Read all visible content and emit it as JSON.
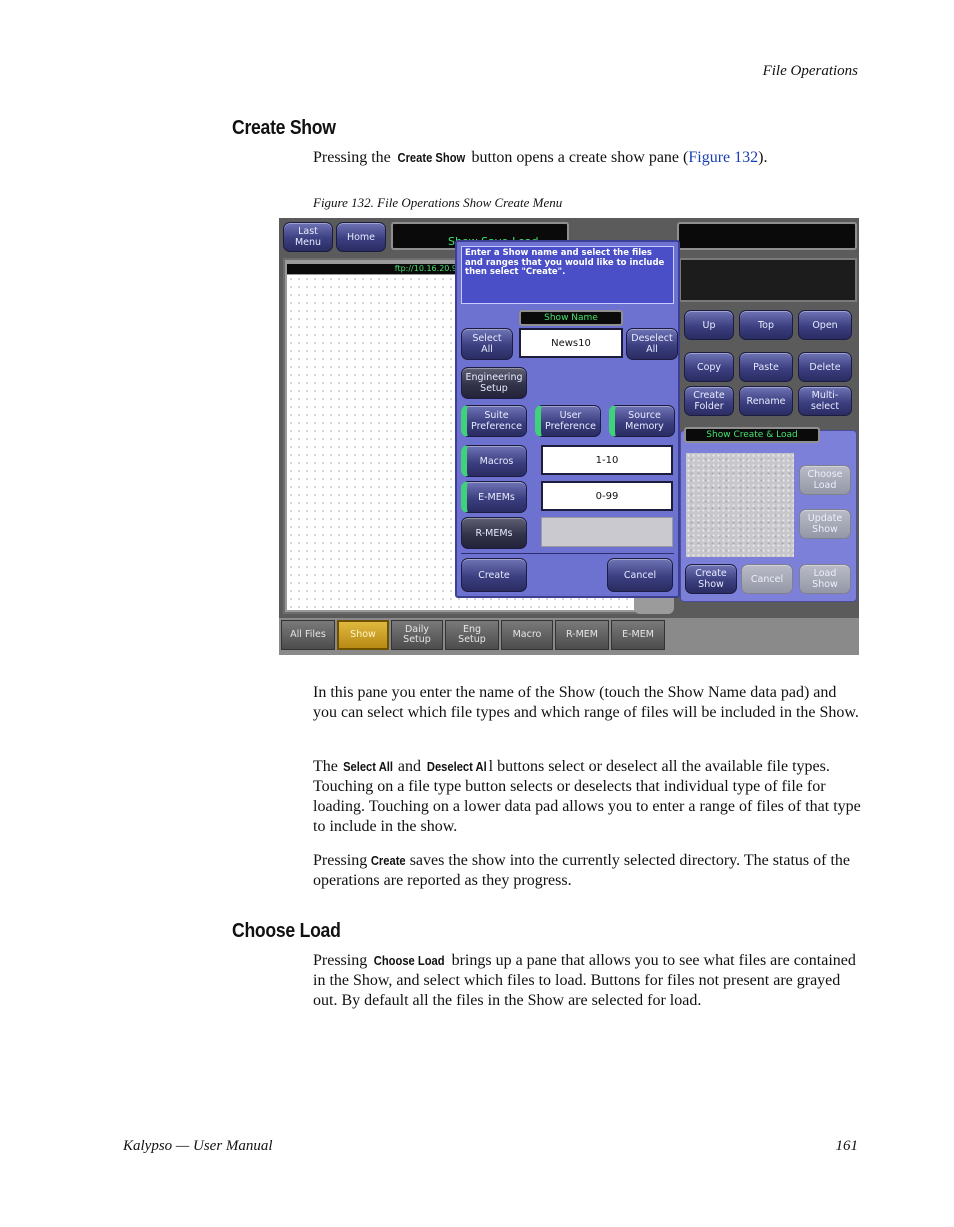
{
  "header": {
    "section": "File Operations"
  },
  "create_show": {
    "heading": "Create Show",
    "intro": {
      "pre": "Pressing the ",
      "kw": "Create Show",
      "mid": " button opens a create show pane (",
      "link": "Figure 132",
      "post": ")."
    },
    "caption": "Figure 132.  File Operations Show Create Menu",
    "para1": "In this pane you enter the name of the Show (touch the Show Name data pad) and you can select which file types and which range of files will be included in the Show.",
    "para2": {
      "pre": "The ",
      "kw1": "Select All",
      "and": " and ",
      "kw2": "Deselect Al",
      "post": "l buttons select or deselect all the available file types. Touching on a file type button selects or deselects that individual type of file for loading. Touching on a lower data pad allows you to enter a range of files of that type to include in the show."
    },
    "para3": {
      "pre": "Pressing ",
      "kw": "Create",
      "post": " saves the show into the currently selected directory. The status of the operations are reported as they progress."
    }
  },
  "choose_load": {
    "heading": "Choose Load",
    "para": {
      "pre": "Pressing ",
      "kw": "Choose Load",
      "post": " brings up a pane that allows you to see what files are contained in the Show, and select which files to load. Buttons for files not present are grayed out. By default all the files in the Show are selected for load."
    }
  },
  "screenshot": {
    "top": {
      "last_menu": "Last\nMenu",
      "home": "Home",
      "title": "Show Save-Load",
      "path": "ftp://10.16.20.9"
    },
    "dialog": {
      "instructions": "Enter a Show name and select the files and ranges that you would like to include then select \"Create\".",
      "show_name_label": "Show Name",
      "show_name_value": "News10",
      "select_all": "Select\nAll",
      "deselect_all": "Deselect\nAll",
      "engineering_setup": "Engineering\nSetup",
      "suite_preference": "Suite\nPreference",
      "user_preference": "User\nPreference",
      "source_memory": "Source\nMemory",
      "macros": "Macros",
      "macros_range": "1-10",
      "emems": "E-MEMs",
      "emems_range": "0-99",
      "rmems": "R-MEMs",
      "create": "Create",
      "cancel": "Cancel"
    },
    "right": {
      "up": "Up",
      "top": "Top",
      "open": "Open",
      "copy": "Copy",
      "paste": "Paste",
      "delete": "Delete",
      "create_folder": "Create\nFolder",
      "rename": "Rename",
      "multi_select": "Multi-\nselect",
      "show_create_load": "Show Create & Load",
      "choose_load": "Choose\nLoad",
      "update_show": "Update\nShow",
      "create_show": "Create\nShow",
      "cancel": "Cancel",
      "load_show": "Load\nShow"
    },
    "tabs": [
      "All Files",
      "Show",
      "Daily\nSetup",
      "Eng\nSetup",
      "Macro",
      "R-MEM",
      "E-MEM"
    ]
  },
  "footer": {
    "left": "Kalypso — User Manual",
    "page": "161"
  }
}
